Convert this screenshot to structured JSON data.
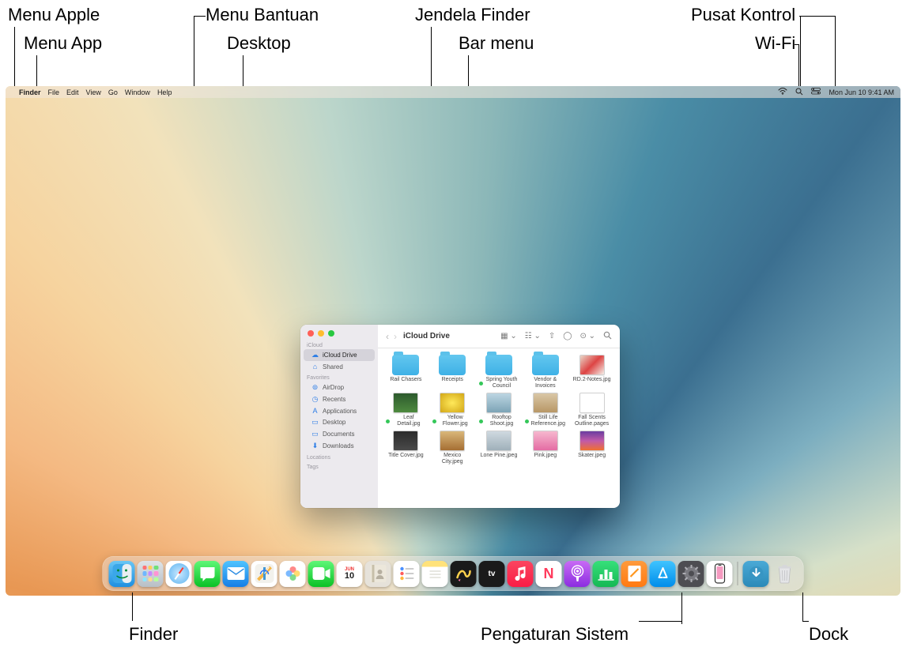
{
  "callouts": {
    "menu_apple": "Menu Apple",
    "menu_app": "Menu App",
    "menu_bantuan": "Menu Bantuan",
    "desktop": "Desktop",
    "jendela_finder": "Jendela Finder",
    "bar_menu": "Bar menu",
    "pusat_kontrol": "Pusat Kontrol",
    "wifi": "Wi-Fi",
    "finder": "Finder",
    "pengaturan_sistem": "Pengaturan Sistem",
    "dock": "Dock"
  },
  "menubar": {
    "app": "Finder",
    "items": [
      "File",
      "Edit",
      "View",
      "Go",
      "Window",
      "Help"
    ],
    "datetime": "Mon Jun 10  9:41 AM"
  },
  "finder": {
    "title": "iCloud Drive",
    "sidebar": {
      "sections": [
        {
          "label": "iCloud",
          "items": [
            {
              "icon": "☁",
              "label": "iCloud Drive",
              "selected": true
            },
            {
              "icon": "⌂",
              "label": "Shared",
              "selected": false
            }
          ]
        },
        {
          "label": "Favorites",
          "items": [
            {
              "icon": "⊚",
              "label": "AirDrop"
            },
            {
              "icon": "◷",
              "label": "Recents"
            },
            {
              "icon": "A",
              "label": "Applications"
            },
            {
              "icon": "▭",
              "label": "Desktop"
            },
            {
              "icon": "▭",
              "label": "Documents"
            },
            {
              "icon": "⬇",
              "label": "Downloads"
            }
          ]
        },
        {
          "label": "Locations",
          "items": []
        },
        {
          "label": "Tags",
          "items": []
        }
      ]
    },
    "files": [
      {
        "kind": "folder",
        "label": "Rail Chasers"
      },
      {
        "kind": "folder",
        "label": "Receipts"
      },
      {
        "kind": "folder",
        "label": "Spring Youth Council",
        "tagged": true
      },
      {
        "kind": "folder",
        "label": "Vendor & Invoices"
      },
      {
        "kind": "image",
        "label": "RD.2-Notes.jpg",
        "bg": "linear-gradient(135deg,#e8d6c8,#d44,#f4efe8)"
      },
      {
        "kind": "image",
        "label": "Leaf Detail.jpg",
        "tagged": true,
        "bg": "linear-gradient(#2d5a2d,#4e8a3f)"
      },
      {
        "kind": "image",
        "label": "Yellow Flower.jpg",
        "tagged": true,
        "bg": "radial-gradient(#ffe95a,#d2a617)"
      },
      {
        "kind": "image",
        "label": "Rooftop Shoot.jpg",
        "tagged": true,
        "bg": "linear-gradient(#bcd5e2,#7da4b6)"
      },
      {
        "kind": "image",
        "label": "Still Life Reference.jpg",
        "tagged": true,
        "bg": "linear-gradient(#d9c7a6,#b89766)"
      },
      {
        "kind": "doc",
        "label": "Fall Scents Outline.pages",
        "bg": "#fff"
      },
      {
        "kind": "image",
        "label": "Title Cover.jpg",
        "bg": "linear-gradient(#2b2b2b,#4a4a4a)"
      },
      {
        "kind": "image",
        "label": "Mexico City.jpeg",
        "bg": "linear-gradient(#d9b77a,#a56e33)"
      },
      {
        "kind": "image",
        "label": "Lone Pine.jpeg",
        "bg": "linear-gradient(#cfd9e0,#9fb0ba)"
      },
      {
        "kind": "image",
        "label": "Pink.jpeg",
        "bg": "linear-gradient(#f6b8cf,#e46ca3)"
      },
      {
        "kind": "image",
        "label": "Skater.jpeg",
        "bg": "linear-gradient(#6a3da0,#c05aa8,#f07030)"
      }
    ]
  },
  "dock": {
    "apps": [
      {
        "id": "finder",
        "name": "Finder"
      },
      {
        "id": "launchpad",
        "name": "Launchpad"
      },
      {
        "id": "safari",
        "name": "Safari"
      },
      {
        "id": "messages",
        "name": "Messages"
      },
      {
        "id": "mail",
        "name": "Mail"
      },
      {
        "id": "maps",
        "name": "Maps"
      },
      {
        "id": "photos",
        "name": "Photos"
      },
      {
        "id": "facetime",
        "name": "FaceTime"
      },
      {
        "id": "calendar",
        "name": "Calendar",
        "day": "10",
        "month": "JUN"
      },
      {
        "id": "contacts",
        "name": "Contacts"
      },
      {
        "id": "reminders",
        "name": "Reminders"
      },
      {
        "id": "notes",
        "name": "Notes"
      },
      {
        "id": "freeform",
        "name": "Freeform"
      },
      {
        "id": "tv",
        "name": "TV"
      },
      {
        "id": "music",
        "name": "Music"
      },
      {
        "id": "news",
        "name": "News"
      },
      {
        "id": "podcasts",
        "name": "Podcasts"
      },
      {
        "id": "numbers",
        "name": "Numbers"
      },
      {
        "id": "pages",
        "name": "Pages"
      },
      {
        "id": "appstore",
        "name": "App Store"
      },
      {
        "id": "settings",
        "name": "System Settings"
      },
      {
        "id": "iphone",
        "name": "iPhone Mirroring"
      }
    ],
    "right": [
      {
        "id": "downloads",
        "name": "Downloads"
      },
      {
        "id": "trash",
        "name": "Trash"
      }
    ]
  }
}
